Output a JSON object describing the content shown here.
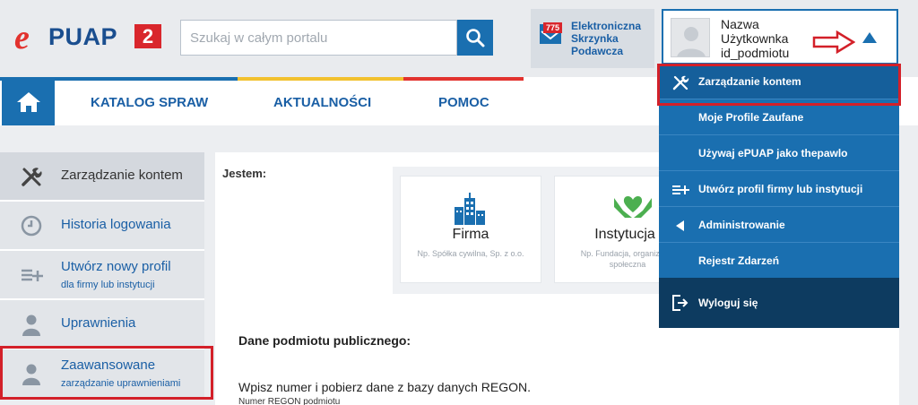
{
  "header": {
    "logo": {
      "mark": "e",
      "name": "PUAP",
      "number": "2"
    },
    "search": {
      "placeholder": "Szukaj w całym portalu"
    },
    "esp": {
      "badge": "775",
      "line1": "Elektroniczna",
      "line2": "Skrzynka",
      "line3": "Podawcza"
    },
    "user": {
      "line1": "Nazwa",
      "line2": "Użytkownka",
      "line3": "id_podmiotu"
    }
  },
  "nav": {
    "items": [
      "KATALOG SPRAW",
      "AKTUALNOŚCI",
      "POMOC"
    ],
    "stripe_colors": [
      "#1a6fb0",
      "#f2c12e",
      "#e2322e"
    ]
  },
  "sidebar": {
    "items": [
      {
        "label": "Zarządzanie kontem",
        "sub": "",
        "icon": "tools-icon"
      },
      {
        "label": "Historia logowania",
        "sub": "",
        "icon": "clock-icon"
      },
      {
        "label": "Utwórz nowy profil",
        "sub": "dla firmy lub instytucji",
        "icon": "add-list-icon"
      },
      {
        "label": "Uprawnienia",
        "sub": "",
        "icon": "person-icon"
      },
      {
        "label": "Zaawansowane",
        "sub": "zarządzanie uprawnieniami",
        "icon": "person-icon"
      }
    ]
  },
  "main": {
    "jestem": "Jestem:",
    "tiles": [
      {
        "title": "Firma",
        "sub": "Np. Spółka cywilna, Sp. z o.o.",
        "icon": "buildings-icon"
      },
      {
        "title": "Instytucja",
        "sub": "Np. Fundacja, organizacja społeczna",
        "icon": "hands-heart-icon"
      }
    ],
    "dane_title": "Dane podmiotu publicznego:",
    "regon_text": "Wpisz numer i pobierz dane z bazy danych REGON.",
    "regon_label": "Numer REGON podmiotu"
  },
  "dropdown": {
    "items": [
      {
        "label": "Zarządzanie kontem",
        "icon": "tools-icon"
      },
      {
        "label": "Moje Profile Zaufane",
        "icon": ""
      },
      {
        "label": "Używaj ePUAP jako thepawlo",
        "icon": ""
      },
      {
        "label": "Utwórz profil firmy lub instytucji",
        "icon": "add-list-icon"
      },
      {
        "label": "Administrowanie",
        "icon": "triangle-left-icon"
      },
      {
        "label": "Rejestr Zdarzeń",
        "icon": ""
      }
    ],
    "logout": {
      "label": "Wyloguj się",
      "icon": "logout-icon"
    }
  },
  "colors": {
    "brand_blue": "#1a6fb0",
    "brand_red": "#e2322e",
    "highlight_red": "#d32029"
  }
}
